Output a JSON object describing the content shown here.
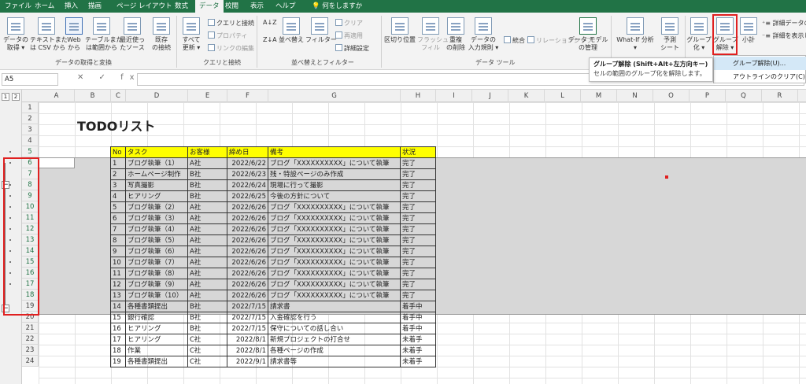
{
  "tabs": [
    "ファイル",
    "ホーム",
    "挿入",
    "描画",
    "ページ レイアウト",
    "数式",
    "データ",
    "校閲",
    "表示",
    "ヘルプ",
    "何をしますか"
  ],
  "active_tab": "データ",
  "ribbon": {
    "get_data": "データの\n取得 ▾",
    "from_text": "テキストまた\nは CSV から",
    "from_web": "Web\nから",
    "from_table": "テーブルまた\nは範囲から",
    "recent": "最近使っ\nたソース",
    "existing": "既存\nの接続",
    "group_get": "データの取得と変換",
    "refresh": "すべて\n更新 ▾",
    "queries": "クエリと接続",
    "properties": "プロパティ",
    "edit_links": "リンクの編集",
    "group_conn": "クエリと接続",
    "sort_az": "A↓Z",
    "sort_za": "Z↓A",
    "sort": "並べ替え",
    "filter": "フィルター",
    "clear": "クリア",
    "reapply": "再適用",
    "advanced": "詳細設定",
    "group_sort": "並べ替えとフィルター",
    "text_to_cols": "区切り位置",
    "flash_fill": "フラッシュ\nフィル",
    "remove_dup": "重複\nの削除",
    "validation": "データの\n入力規則 ▾",
    "consolidate": "統合",
    "relationships": "リレーションシップ",
    "data_model": "データ モデル\nの管理",
    "group_tools": "データ ツール",
    "whatif": "What-If 分析\n▾",
    "forecast": "予測\nシート",
    "group_forecast": "予測",
    "group_btn": "グループ\n化 ▾",
    "ungroup_btn": "グループ\n解除 ▾",
    "subtotal": "小計",
    "show_detail": "詳細データの",
    "hide_detail": "詳細を表示し"
  },
  "tooltip": {
    "title": "グループ解除 (Shift+Alt+左方向キー)",
    "desc": "セルの範囲のグループ化を解除します。"
  },
  "menu": {
    "ungroup": "グループ解除(U)...",
    "clear_outline": "アウトラインのクリア(C)"
  },
  "name_box": "A5",
  "formula_icons": "✕ ✓ fx",
  "outline_levels": [
    "1",
    "2"
  ],
  "columns": [
    "A",
    "B",
    "C",
    "D",
    "E",
    "F",
    "G",
    "H",
    "I",
    "J",
    "K",
    "L",
    "M",
    "N",
    "O",
    "P",
    "Q",
    "R"
  ],
  "rows": [
    "1",
    "2",
    "3",
    "4",
    "5",
    "6",
    "7",
    "8",
    "9",
    "10",
    "11",
    "12",
    "13",
    "14",
    "15",
    "16",
    "17",
    "18",
    "19",
    "20",
    "21",
    "22",
    "23",
    "24"
  ],
  "sheet_title": "TODOリスト",
  "table": {
    "headers": [
      "No",
      "タスク",
      "お客様",
      "締め日",
      "備考",
      "状況"
    ],
    "rows": [
      [
        "1",
        "ブログ執筆（1）",
        "A社",
        "2022/6/22",
        "ブログ「XXXXXXXXXX」について執筆",
        "完了"
      ],
      [
        "2",
        "ホームページ制作",
        "B社",
        "2022/6/23",
        "残・特設ページのみ作成",
        "完了"
      ],
      [
        "3",
        "写真撮影",
        "B社",
        "2022/6/24",
        "現場に行って撮影",
        "完了"
      ],
      [
        "4",
        "ヒアリング",
        "B社",
        "2022/6/25",
        "今後の方針について",
        "完了"
      ],
      [
        "5",
        "ブログ執筆（2）",
        "A社",
        "2022/6/26",
        "ブログ「XXXXXXXXXX」について執筆",
        "完了"
      ],
      [
        "6",
        "ブログ執筆（3）",
        "A社",
        "2022/6/26",
        "ブログ「XXXXXXXXXX」について執筆",
        "完了"
      ],
      [
        "7",
        "ブログ執筆（4）",
        "A社",
        "2022/6/26",
        "ブログ「XXXXXXXXXX」について執筆",
        "完了"
      ],
      [
        "8",
        "ブログ執筆（5）",
        "A社",
        "2022/6/26",
        "ブログ「XXXXXXXXXX」について執筆",
        "完了"
      ],
      [
        "9",
        "ブログ執筆（6）",
        "A社",
        "2022/6/26",
        "ブログ「XXXXXXXXXX」について執筆",
        "完了"
      ],
      [
        "10",
        "ブログ執筆（7）",
        "A社",
        "2022/6/26",
        "ブログ「XXXXXXXXXX」について執筆",
        "完了"
      ],
      [
        "11",
        "ブログ執筆（8）",
        "A社",
        "2022/6/26",
        "ブログ「XXXXXXXXXX」について執筆",
        "完了"
      ],
      [
        "12",
        "ブログ執筆（9）",
        "A社",
        "2022/6/26",
        "ブログ「XXXXXXXXXX」について執筆",
        "完了"
      ],
      [
        "13",
        "ブログ執筆（10）",
        "A社",
        "2022/6/26",
        "ブログ「XXXXXXXXXX」について執筆",
        "完了"
      ],
      [
        "14",
        "各種書類提出",
        "B社",
        "2022/7/15",
        "請求書",
        "着手中"
      ],
      [
        "15",
        "銀行確認",
        "B社",
        "2022/7/15",
        "入金確認を行う",
        "着手中"
      ],
      [
        "16",
        "ヒアリング",
        "B社",
        "2022/7/15",
        "保守についての話し合い",
        "着手中"
      ],
      [
        "17",
        "ヒアリング",
        "C社",
        "2022/8/1",
        "新規プロジェクトの打合せ",
        "未着手"
      ],
      [
        "18",
        "作業",
        "C社",
        "2022/8/1",
        "各種ページの作成",
        "未着手"
      ],
      [
        "19",
        "各種書類提出",
        "C社",
        "2022/9/1",
        "請求書等",
        "未着手"
      ]
    ]
  }
}
